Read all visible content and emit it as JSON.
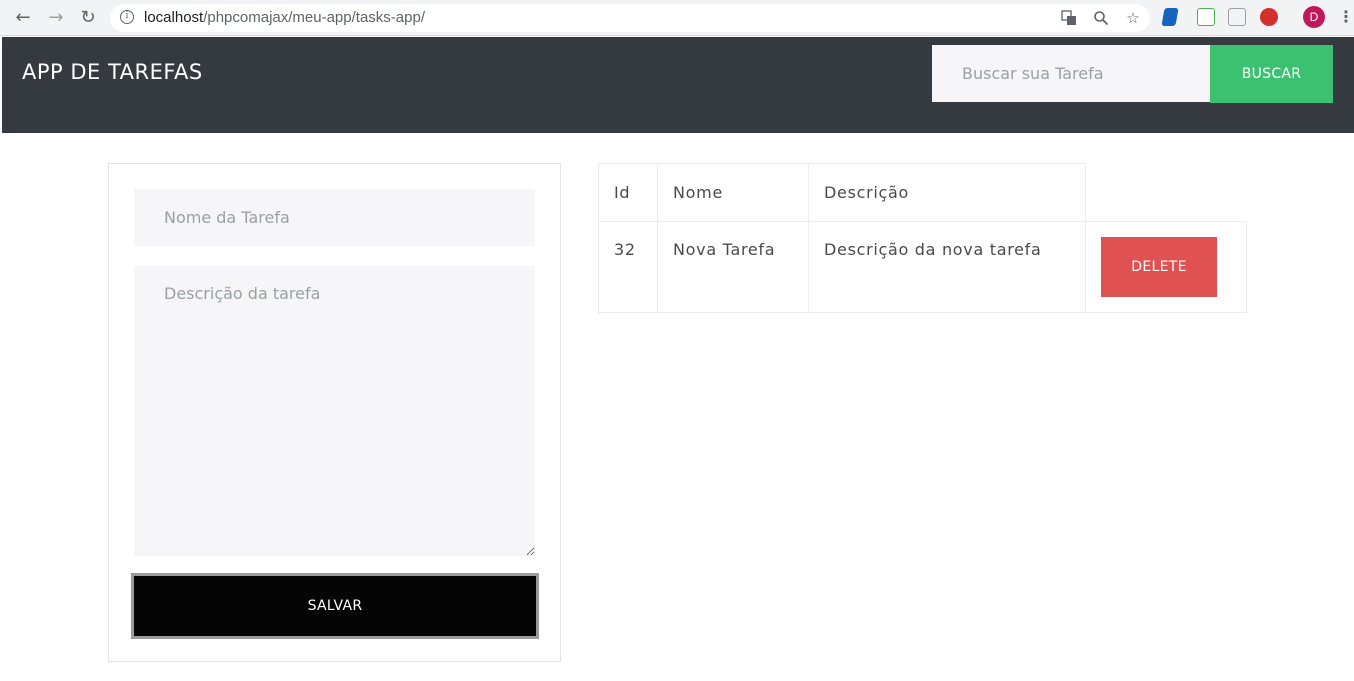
{
  "browser": {
    "url_host": "localhost",
    "url_path": "/phpcomajax/meu-app/tasks-app/",
    "profile_initial": "D"
  },
  "navbar": {
    "brand": "APP DE TAREFAS",
    "search_placeholder": "Buscar sua Tarefa",
    "search_button": "BUSCAR"
  },
  "form": {
    "name_placeholder": "Nome da Tarefa",
    "description_placeholder": "Descrição da tarefa",
    "save_button": "SALVAR"
  },
  "table": {
    "headers": [
      "Id",
      "Nome",
      "Descrição"
    ],
    "rows": [
      {
        "id": "32",
        "nome": "Nova Tarefa",
        "descricao": "Descrição da nova tarefa",
        "action": "DELETE"
      }
    ]
  },
  "colors": {
    "navbar_bg": "#343a40",
    "search_button": "#3cc170",
    "delete_button": "#e05252",
    "save_button": "#050505"
  }
}
